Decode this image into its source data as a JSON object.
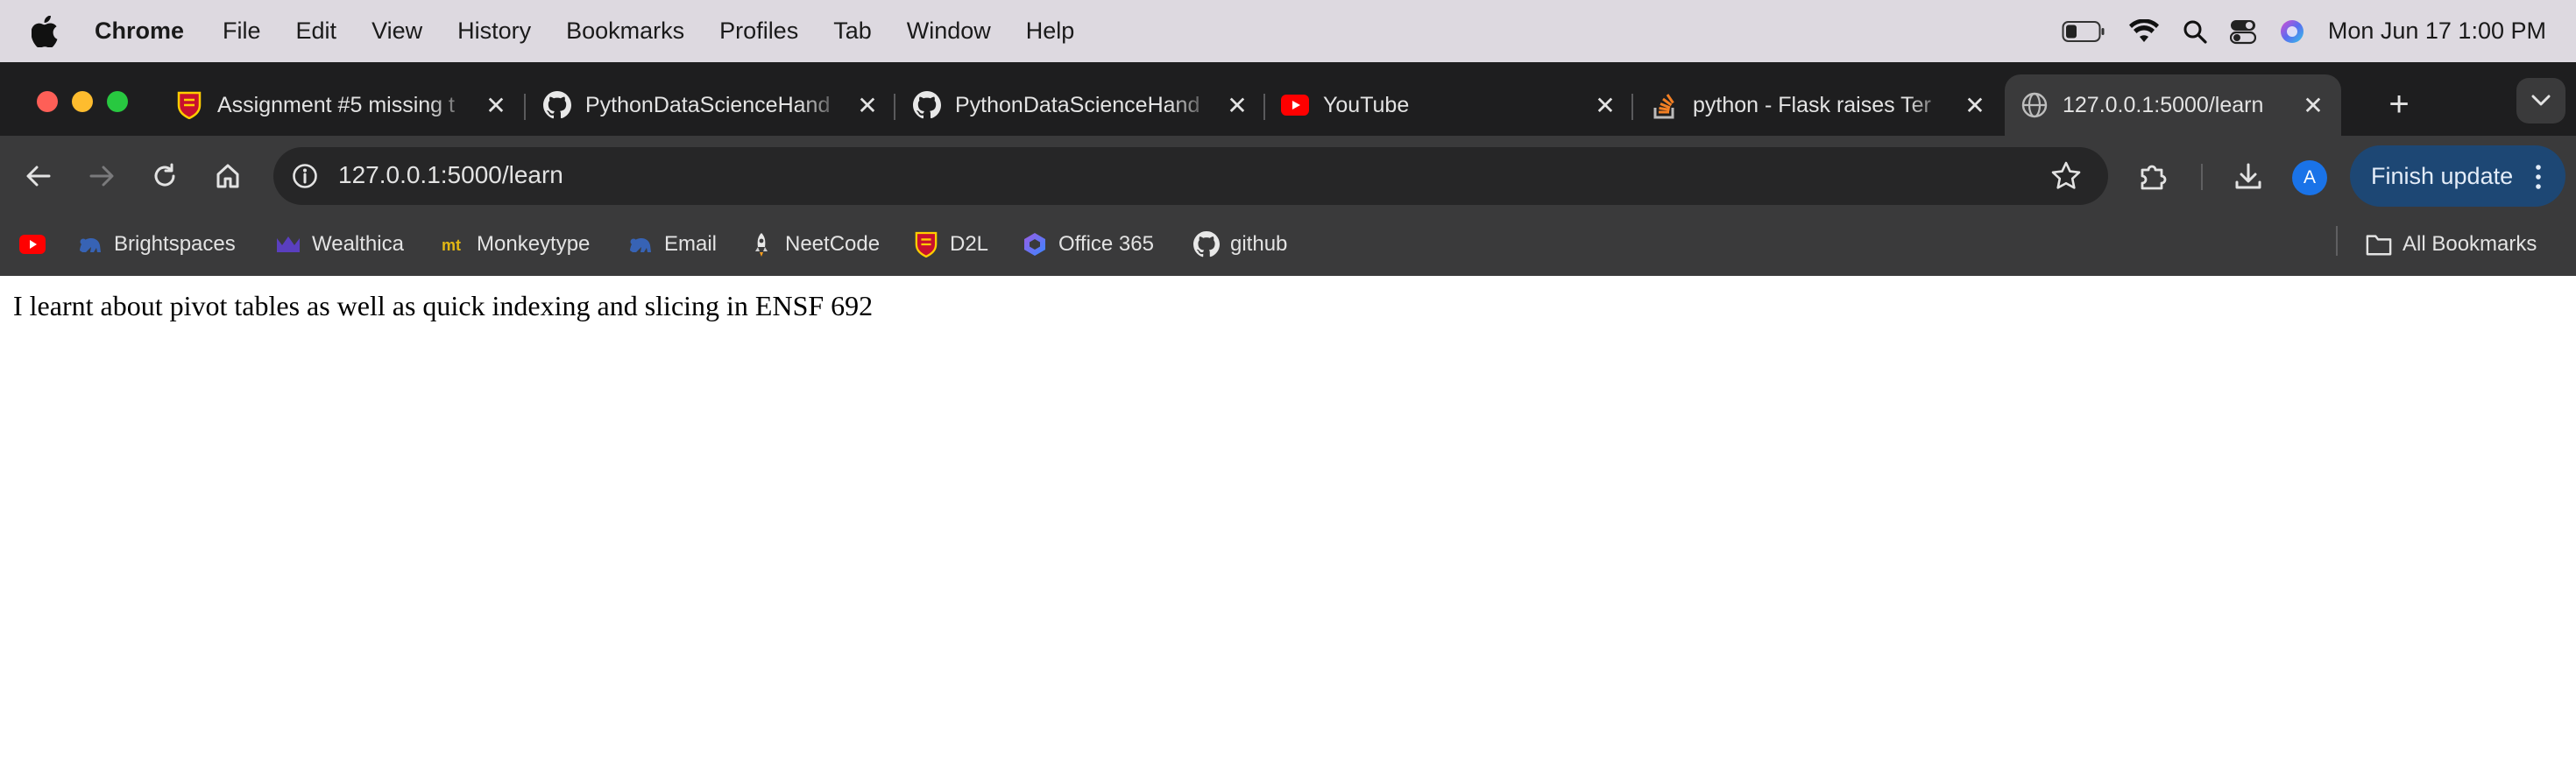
{
  "menubar": {
    "app_name": "Chrome",
    "items": [
      "File",
      "Edit",
      "View",
      "History",
      "Bookmarks",
      "Profiles",
      "Tab",
      "Window",
      "Help"
    ],
    "clock": "Mon Jun 17  1:00 PM"
  },
  "tabs": [
    {
      "title": "Assignment #5 missing t",
      "icon": "university-crest-icon",
      "active": false
    },
    {
      "title": "PythonDataScienceHand",
      "icon": "github-icon",
      "active": false
    },
    {
      "title": "PythonDataScienceHand",
      "icon": "github-icon",
      "active": false
    },
    {
      "title": "YouTube",
      "icon": "youtube-icon",
      "active": false
    },
    {
      "title": "python - Flask raises Ter",
      "icon": "stackoverflow-icon",
      "active": false
    },
    {
      "title": "127.0.0.1:5000/learn",
      "icon": "globe-icon",
      "active": true
    }
  ],
  "toolbar": {
    "url": "127.0.0.1:5000/learn",
    "avatar_letter": "A",
    "finish_update_label": "Finish update"
  },
  "bookmarks": [
    {
      "label": "",
      "icon": "youtube-icon"
    },
    {
      "label": "Brightspaces",
      "icon": "bison-icon"
    },
    {
      "label": "Wealthica",
      "icon": "wealthica-icon"
    },
    {
      "label": "Monkeytype",
      "icon": "monkeytype-icon"
    },
    {
      "label": "Email",
      "icon": "bison-icon"
    },
    {
      "label": "NeetCode",
      "icon": "rocket-icon"
    },
    {
      "label": "D2L",
      "icon": "university-crest-icon"
    },
    {
      "label": "Office 365",
      "icon": "office-icon"
    },
    {
      "label": "github",
      "icon": "github-icon"
    }
  ],
  "all_bookmarks_label": "All Bookmarks",
  "page": {
    "text": "I learnt about pivot tables as well as quick indexing and slicing in ENSF 692"
  },
  "colors": {
    "menubar_bg": "#ddd9e0",
    "tabstrip_bg": "#1e1e1f",
    "toolbar_bg": "#3a3a3b",
    "omnibox_bg": "#262627",
    "finish_update_bg": "#1d4774",
    "page_bg": "#ffffff"
  }
}
